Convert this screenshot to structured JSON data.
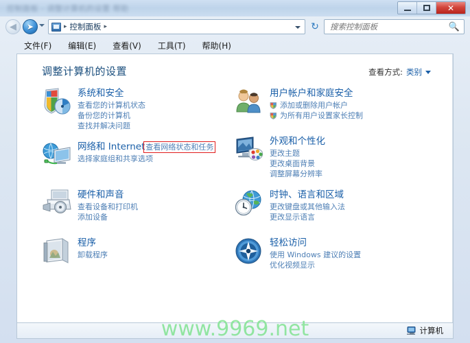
{
  "window": {
    "titlebar_text_blurred": "控制面板 - 调整计算机的设置 帮助",
    "buttons": {
      "minimize": "最小化",
      "maximize": "最大化",
      "close": "✕"
    }
  },
  "navigation": {
    "back_label": "◀",
    "forward_label": "➤",
    "breadcrumb": "控制面板",
    "breadcrumb_sep": "▸",
    "refresh_label": "↻",
    "address_icon": "control-panel-icon"
  },
  "search": {
    "placeholder": "搜索控制面板",
    "value": "",
    "icon": "🔍"
  },
  "menubar": {
    "items": [
      {
        "label": "文件(F)"
      },
      {
        "label": "编辑(E)"
      },
      {
        "label": "查看(V)"
      },
      {
        "label": "工具(T)"
      },
      {
        "label": "帮助(H)"
      }
    ]
  },
  "main": {
    "header": "调整计算机的设置",
    "view_by_label": "查看方式:",
    "view_by_value": "类别"
  },
  "categories_left": [
    {
      "icon": "system-security-shield-icon",
      "title": "系统和安全",
      "links": [
        {
          "label": "查看您的计算机状态",
          "shield": false,
          "highlighted": false
        },
        {
          "label": "备份您的计算机",
          "shield": false,
          "highlighted": false
        },
        {
          "label": "查找并解决问题",
          "shield": false,
          "highlighted": false
        }
      ]
    },
    {
      "icon": "network-internet-icon",
      "title": "网络和 Internet",
      "links": [
        {
          "label": "查看网络状态和任务",
          "shield": false,
          "highlighted": true
        },
        {
          "label": "选择家庭组和共享选项",
          "shield": false,
          "highlighted": false
        }
      ]
    },
    {
      "icon": "hardware-sound-printer-icon",
      "title": "硬件和声音",
      "links": [
        {
          "label": "查看设备和打印机",
          "shield": false,
          "highlighted": false
        },
        {
          "label": "添加设备",
          "shield": false,
          "highlighted": false
        }
      ]
    },
    {
      "icon": "programs-box-icon",
      "title": "程序",
      "links": [
        {
          "label": "卸载程序",
          "shield": false,
          "highlighted": false
        }
      ]
    }
  ],
  "categories_right": [
    {
      "icon": "user-accounts-family-icon",
      "title": "用户帐户和家庭安全",
      "links": [
        {
          "label": "添加或删除用户帐户",
          "shield": true,
          "highlighted": false
        },
        {
          "label": "为所有用户设置家长控制",
          "shield": true,
          "highlighted": false
        }
      ]
    },
    {
      "icon": "appearance-personalization-icon",
      "title": "外观和个性化",
      "links": [
        {
          "label": "更改主题",
          "shield": false,
          "highlighted": false
        },
        {
          "label": "更改桌面背景",
          "shield": false,
          "highlighted": false
        },
        {
          "label": "调整屏幕分辨率",
          "shield": false,
          "highlighted": false
        }
      ]
    },
    {
      "icon": "clock-language-region-icon",
      "title": "时钟、语言和区域",
      "links": [
        {
          "label": "更改键盘或其他输入法",
          "shield": false,
          "highlighted": false
        },
        {
          "label": "更改显示语言",
          "shield": false,
          "highlighted": false
        }
      ]
    },
    {
      "icon": "ease-of-access-icon",
      "title": "轻松访问",
      "links": [
        {
          "label": "使用 Windows 建议的设置",
          "shield": false,
          "highlighted": false
        },
        {
          "label": "优化视频显示",
          "shield": false,
          "highlighted": false
        }
      ]
    }
  ],
  "statusbar": {
    "computer_label": "计算机",
    "computer_icon": "computer-icon"
  },
  "watermark": {
    "text": "www.9969.net"
  },
  "colors": {
    "link_blue": "#4e7fb5",
    "title_blue": "#1a5fa8",
    "header_blue": "#1a4e7d",
    "highlight_red": "#e01b1b",
    "watermark_green": "#8ae49a",
    "close_red": "#d2453c"
  }
}
